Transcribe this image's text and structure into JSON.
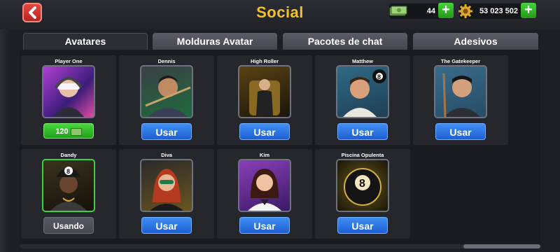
{
  "header": {
    "title": "Social",
    "cash": "44",
    "coins": "53 023 502"
  },
  "tabs": [
    {
      "label": "Avatares",
      "active": true
    },
    {
      "label": "Molduras Avatar",
      "active": false
    },
    {
      "label": "Pacotes de chat",
      "active": false
    },
    {
      "label": "Adesivos",
      "active": false
    }
  ],
  "avatars": [
    {
      "name": "Player One",
      "action": "120",
      "state": "price"
    },
    {
      "name": "Dennis",
      "action": "Usar",
      "state": "use"
    },
    {
      "name": "High Roller",
      "action": "Usar",
      "state": "use"
    },
    {
      "name": "Matthew",
      "action": "Usar",
      "state": "use"
    },
    {
      "name": "The Gatekeeper",
      "action": "Usar",
      "state": "use"
    },
    {
      "name": "Dandy",
      "action": "Usando",
      "state": "using"
    },
    {
      "name": "Diva",
      "action": "Usar",
      "state": "use"
    },
    {
      "name": "Kim",
      "action": "Usar",
      "state": "use"
    },
    {
      "name": "Piscina Opulenta",
      "action": "Usar",
      "state": "use"
    }
  ],
  "colors": {
    "accent_title": "#f2c12e",
    "use_button": "#2f77e6",
    "price_button": "#33c02a",
    "equipped_border": "#39d43a"
  },
  "icons": {
    "back": "chevron-left-icon",
    "cash": "cash-icon",
    "coins": "coin-gear-icon",
    "add": "plus-icon"
  }
}
